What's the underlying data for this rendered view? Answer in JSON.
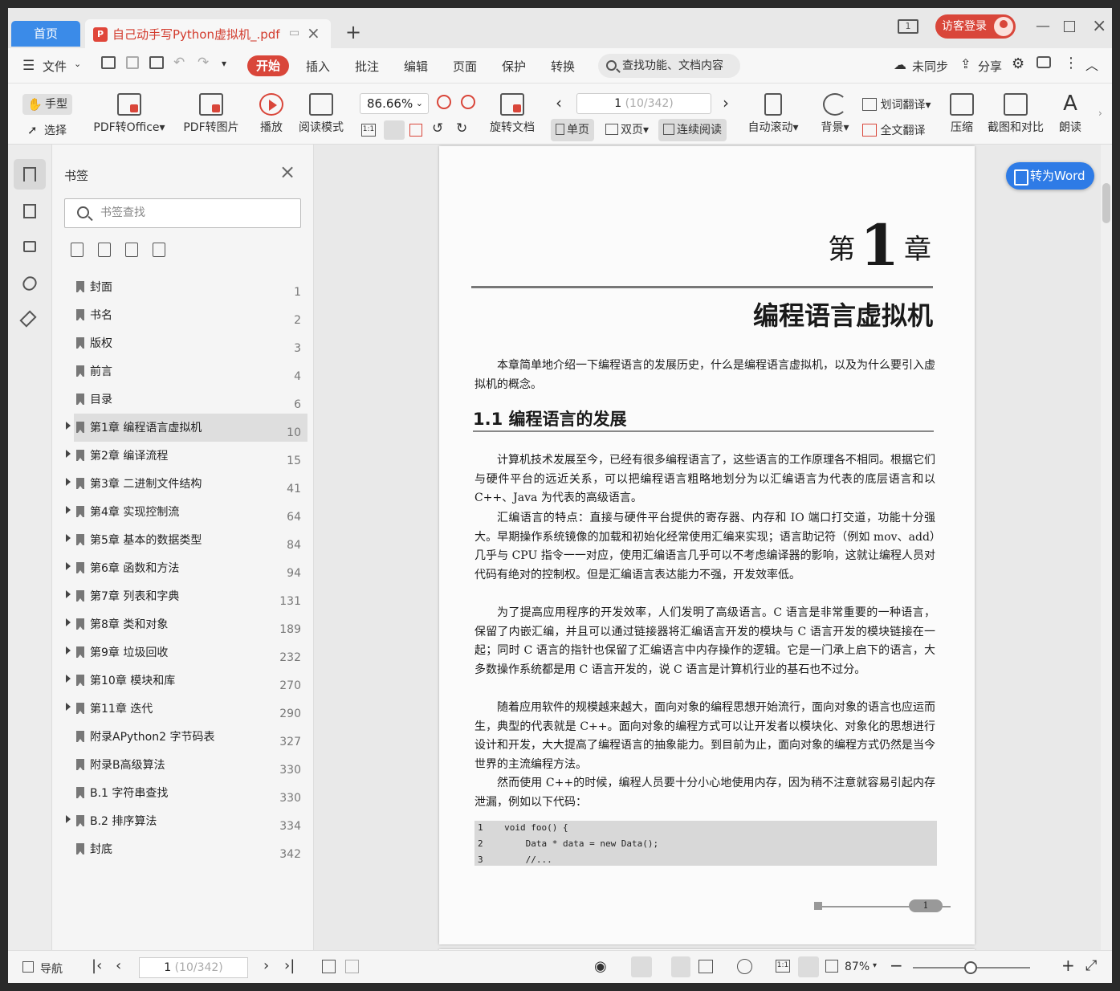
{
  "titlebar": {
    "home_tab": "首页",
    "doc_tab": "自己动手写Python虚拟机_.pdf",
    "login": "访客登录",
    "page_icon": "1"
  },
  "menubar": {
    "file": "文件",
    "items": [
      "开始",
      "插入",
      "批注",
      "编辑",
      "页面",
      "保护",
      "转换"
    ],
    "search_placeholder": "查找功能、文档内容",
    "sync": "未同步",
    "share": "分享"
  },
  "toolbar": {
    "hand": "手型",
    "select": "选择",
    "pdf_to_office": "PDF转Office",
    "pdf_to_image": "PDF转图片",
    "play": "播放",
    "read_mode": "阅读模式",
    "zoom": "86.66%",
    "rotate": "旋转文档",
    "page_current": "1",
    "page_total": "(10/342)",
    "single": "单页",
    "double": "双页",
    "continuous": "连续阅读",
    "auto_scroll": "自动滚动",
    "background": "背景",
    "word_translate": "划词翻译",
    "full_translate": "全文翻译",
    "compress": "压缩",
    "screenshot": "截图和对比",
    "read_aloud": "朗读",
    "one_to_one": "1:1"
  },
  "bookmarks": {
    "title": "书签",
    "search_placeholder": "书签查找",
    "items": [
      {
        "label": "封面",
        "page": "1",
        "expandable": false
      },
      {
        "label": "书名",
        "page": "2",
        "expandable": false
      },
      {
        "label": "版权",
        "page": "3",
        "expandable": false
      },
      {
        "label": "前言",
        "page": "4",
        "expandable": false
      },
      {
        "label": "目录",
        "page": "6",
        "expandable": false
      },
      {
        "label": "第1章 编程语言虚拟机",
        "page": "10",
        "expandable": true
      },
      {
        "label": "第2章 编译流程",
        "page": "15",
        "expandable": true
      },
      {
        "label": "第3章 二进制文件结构",
        "page": "41",
        "expandable": true
      },
      {
        "label": "第4章 实现控制流",
        "page": "64",
        "expandable": true
      },
      {
        "label": "第5章 基本的数据类型",
        "page": "84",
        "expandable": true
      },
      {
        "label": "第6章 函数和方法",
        "page": "94",
        "expandable": true
      },
      {
        "label": "第7章 列表和字典",
        "page": "131",
        "expandable": true
      },
      {
        "label": "第8章 类和对象",
        "page": "189",
        "expandable": true
      },
      {
        "label": "第9章 垃圾回收",
        "page": "232",
        "expandable": true
      },
      {
        "label": "第10章 模块和库",
        "page": "270",
        "expandable": true
      },
      {
        "label": "第11章 迭代",
        "page": "290",
        "expandable": true
      },
      {
        "label": "附录APython2 字节码表",
        "page": "327",
        "expandable": false
      },
      {
        "label": "附录B高级算法",
        "page": "330",
        "expandable": false
      },
      {
        "label": "B.1 字符串查找",
        "page": "330",
        "expandable": false
      },
      {
        "label": "B.2 排序算法",
        "page": "334",
        "expandable": true
      },
      {
        "label": "封底",
        "page": "342",
        "expandable": false
      }
    ]
  },
  "document": {
    "chapter_prefix": "第",
    "chapter_num": "1",
    "chapter_suffix": "章",
    "chapter_title": "编程语言虚拟机",
    "intro": "本章简单地介绍一下编程语言的发展历史，什么是编程语言虚拟机，以及为什么要引入虚拟机的概念。",
    "section_title": "1.1   编程语言的发展",
    "paragraphs": [
      "计算机技术发展至今，已经有很多编程语言了，这些语言的工作原理各不相同。根据它们与硬件平台的远近关系，可以把编程语言粗略地划分为以汇编语言为代表的底层语言和以 C++、Java 为代表的高级语言。",
      "汇编语言的特点：直接与硬件平台提供的寄存器、内存和 IO 端口打交道，功能十分强大。早期操作系统镜像的加载和初始化经常使用汇编来实现；语言助记符（例如 mov、add）几乎与 CPU 指令一一对应，使用汇编语言几乎可以不考虑编译器的影响，这就让编程人员对代码有绝对的控制权。但是汇编语言表达能力不强，开发效率低。",
      "为了提高应用程序的开发效率，人们发明了高级语言。C 语言是非常重要的一种语言，保留了内嵌汇编，并且可以通过链接器将汇编语言开发的模块与 C 语言开发的模块链接在一起；同时 C 语言的指针也保留了汇编语言中内存操作的逻辑。它是一门承上启下的语言，大多数操作系统都是用 C 语言开发的，说 C 语言是计算机行业的基石也不过分。",
      "随着应用软件的规模越来越大，面向对象的编程思想开始流行，面向对象的语言也应运而生，典型的代表就是 C++。面向对象的编程方式可以让开发者以模块化、对象化的思想进行设计和开发，大大提高了编程语言的抽象能力。到目前为止，面向对象的编程方式仍然是当今世界的主流编程方法。",
      "然而使用 C++的时候，编程人员要十分小心地使用内存，因为稍不注意就容易引起内存泄漏，例如以下代码："
    ],
    "code": [
      "1    void foo() {",
      "2        Data * data = new Data();",
      "3        //..."
    ],
    "page_number": "1",
    "to_word": "转为Word"
  },
  "statusbar": {
    "nav": "导航",
    "page_current": "1",
    "page_total": "(10/342)",
    "zoom": "87%",
    "one_to_one": "1:1"
  }
}
